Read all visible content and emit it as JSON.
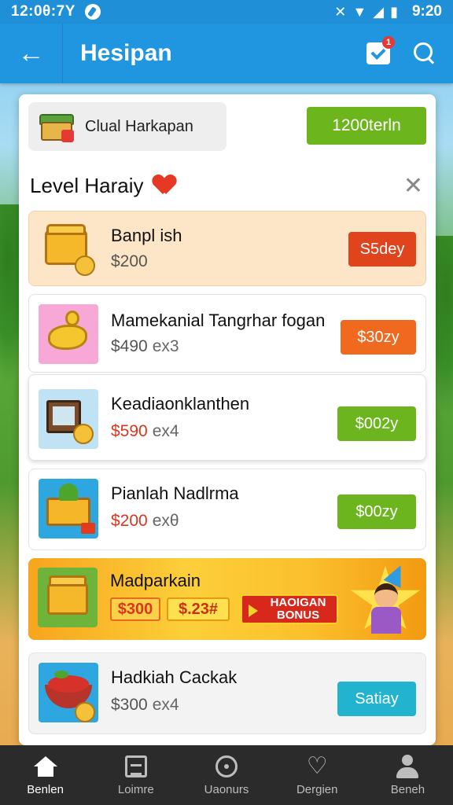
{
  "status_bar": {
    "time_left": "12:0θ:7Y",
    "time_right": "9:20"
  },
  "app_bar": {
    "title": "Hesipan",
    "notification_count": "1"
  },
  "top_row": {
    "chip_label": "Clual Harkapan",
    "button_label": "1200terln"
  },
  "level": {
    "title": "Level Haraiy"
  },
  "items": [
    {
      "name": "Banpl ish",
      "price": "$200",
      "qty": "",
      "button": "S5dey",
      "button_color": "#e0441d"
    },
    {
      "name": "Mamekanial Tangrhar fogan",
      "price": "$490",
      "qty": "ex3",
      "button": "$30zy",
      "button_color": "#ef6a1f"
    },
    {
      "name": "Keadiaonklanthen",
      "price": "$590",
      "qty": "ex4",
      "button": "$002y",
      "button_color": "#6db51f"
    },
    {
      "name": "Pianlah Nadlrma",
      "price": "$200",
      "qty": "exθ",
      "button": "$00zy",
      "button_color": "#6db51f"
    },
    {
      "name": "Madparkain",
      "tag1": "$300",
      "tag2": "$.23#",
      "banner": "HAOIGAN BONUS"
    },
    {
      "name": "Hadkiah Cackak",
      "price": "$300",
      "qty": "ex4",
      "button": "Satiay",
      "button_color": "#22b4cf"
    }
  ],
  "bottom_nav": [
    {
      "label": "Benlen",
      "icon": "home-icon",
      "active": true
    },
    {
      "label": "Loimre",
      "icon": "grid-icon",
      "active": false
    },
    {
      "label": "Uaonurs",
      "icon": "map-pin-icon",
      "active": false
    },
    {
      "label": "Dergien",
      "icon": "heart-icon",
      "active": false
    },
    {
      "label": "Beneh",
      "icon": "user-icon",
      "active": false
    }
  ]
}
